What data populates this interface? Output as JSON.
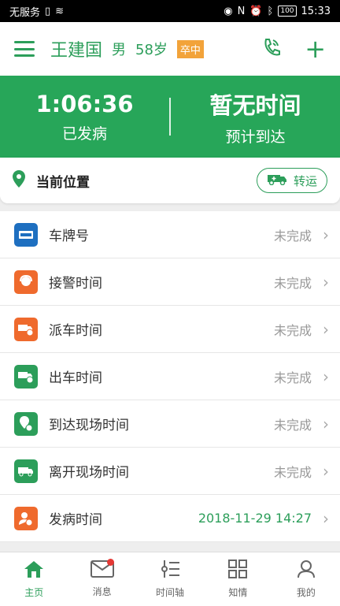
{
  "statusbar": {
    "carrier": "无服务",
    "battery": "100",
    "time": "15:33"
  },
  "header": {
    "name": "王建国",
    "sex": "男",
    "age": "58岁",
    "badge": "卒中"
  },
  "timer": {
    "elapsed": "1:06:36",
    "elapsed_label": "已发病",
    "eta": "暂无时间",
    "eta_label": "预计到达"
  },
  "location": {
    "label": "当前位置",
    "transfer_label": "转运"
  },
  "rows": [
    {
      "label": "车牌号",
      "value": "未完成",
      "icon": "license-plate-icon",
      "color": "#1e6fc0"
    },
    {
      "label": "接警时间",
      "value": "未完成",
      "icon": "call-agent-icon",
      "color": "#ef6a2d"
    },
    {
      "label": "派车时间",
      "value": "未完成",
      "icon": "ambulance-dispatch-icon",
      "color": "#ef6a2d"
    },
    {
      "label": "出车时间",
      "value": "未完成",
      "icon": "ambulance-depart-icon",
      "color": "#2c9e5a"
    },
    {
      "label": "到达现场时间",
      "value": "未完成",
      "icon": "location-clock-icon",
      "color": "#2c9e5a"
    },
    {
      "label": "离开现场时间",
      "value": "未完成",
      "icon": "ambulance-leave-icon",
      "color": "#2c9e5a"
    },
    {
      "label": "发病时间",
      "value": "2018-11-29 14:27",
      "icon": "person-clock-icon",
      "color": "#ef6a2d"
    }
  ],
  "tabs": [
    {
      "label": "主页",
      "icon": "home-icon"
    },
    {
      "label": "消息",
      "icon": "mail-icon"
    },
    {
      "label": "时间轴",
      "icon": "timeline-icon"
    },
    {
      "label": "知情",
      "icon": "grid-icon"
    },
    {
      "label": "我的",
      "icon": "user-icon"
    }
  ],
  "colors": {
    "primary": "#27a659",
    "orange": "#ef6a2d",
    "blue": "#1e6fc0",
    "badge": "#f2a33a"
  }
}
